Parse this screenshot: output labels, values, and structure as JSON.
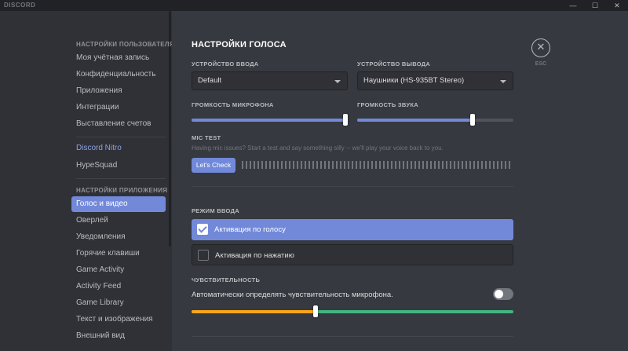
{
  "titlebar": {
    "logo": "DISCORD",
    "minimize": "—",
    "maximize": "☐",
    "close": "✕"
  },
  "sidebar": {
    "user_header": "НАСТРОЙКИ ПОЛЬЗОВАТЕЛЯ",
    "user_items": [
      "Моя учётная запись",
      "Конфиденциальность",
      "Приложения",
      "Интеграции",
      "Выставление счетов"
    ],
    "nitro": "Discord Nitro",
    "hypesquad": "HypeSquad",
    "app_header": "НАСТРОЙКИ ПРИЛОЖЕНИЯ",
    "app_items": [
      "Голос и видео",
      "Оверлей",
      "Уведомления",
      "Горячие клавиши",
      "Game Activity",
      "Activity Feed",
      "Game Library",
      "Текст и изображения",
      "Внешний вид"
    ],
    "active_item": "Голос и видео"
  },
  "main": {
    "title": "НАСТРОЙКИ ГОЛОСА",
    "input_device_label": "УСТРОЙСТВО ВВОДА",
    "input_device_value": "Default",
    "output_device_label": "УСТРОЙСТВО ВЫВОДА",
    "output_device_value": "Наушники (HS-935BT Stereo)",
    "mic_volume_label": "ГРОМКОСТЬ МИКРОФОНА",
    "mic_volume": 1.0,
    "output_volume_label": "ГРОМКОСТЬ ЗВУКА",
    "output_volume": 0.74,
    "mic_test_label": "MIC TEST",
    "mic_test_hint": "Having mic issues? Start a test and say something silly -- we'll play your voice back to you.",
    "lets_check": "Let's Check",
    "input_mode_label": "РЕЖИМ ВВОДА",
    "mode_voice": "Активация по голосу",
    "mode_ptt": "Активация по нажатию",
    "sensitivity_label": "ЧУВСТВИТЕЛЬНОСТЬ",
    "auto_sensitivity": "Автоматически определять чувствительность микрофона.",
    "auto_sensitivity_on": false,
    "sensitivity_level": 0.385
  },
  "esc": {
    "icon": "✕",
    "label": "ESC"
  },
  "colors": {
    "accent": "#7289da",
    "warn": "#faa61a",
    "ok": "#43b581"
  }
}
